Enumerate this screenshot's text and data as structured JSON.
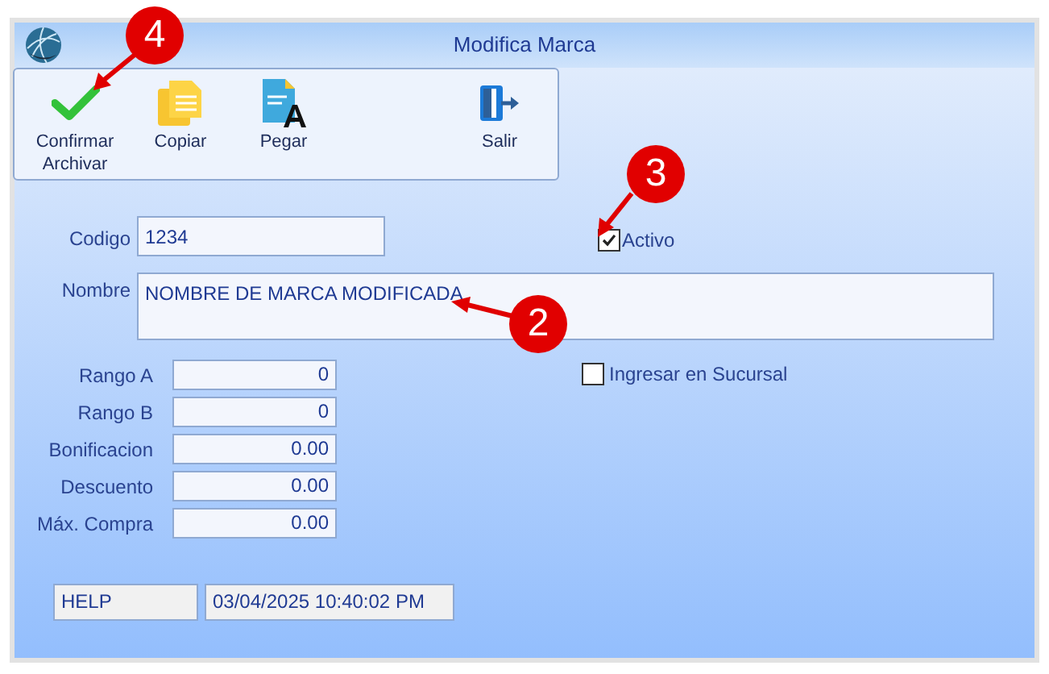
{
  "window": {
    "title": "Modifica Marca"
  },
  "toolbar": [
    {
      "kind": "confirm",
      "label": "Confirmar Archivar"
    },
    {
      "kind": "copy",
      "label": "Copiar"
    },
    {
      "kind": "paste",
      "label": "Pegar"
    },
    {
      "kind": "exit",
      "label": "Salir"
    }
  ],
  "codigo": {
    "label": "Codigo",
    "value": "1234"
  },
  "activo": {
    "label": "Activo",
    "checked": true
  },
  "nombre": {
    "label": "Nombre",
    "value": "NOMBRE DE MARCA MODIFICADA"
  },
  "numeric_fields": [
    {
      "label": "Rango A",
      "value": "0"
    },
    {
      "label": "Rango B",
      "value": "0"
    },
    {
      "label": "Bonificacion",
      "value": "0.00"
    },
    {
      "label": "Descuento",
      "value": "0.00"
    },
    {
      "label": "Máx. Compra",
      "value": "0.00"
    }
  ],
  "sucursal": {
    "label": "Ingresar en Sucursal",
    "checked": false
  },
  "status_bar": [
    "HELP",
    "03/04/2025 10:40:02 PM"
  ],
  "callouts": [
    {
      "number": "4"
    },
    {
      "number": "3"
    },
    {
      "number": "2"
    }
  ]
}
